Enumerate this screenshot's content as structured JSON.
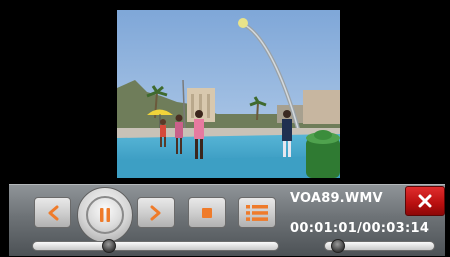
{
  "player": {
    "filename": "VOA89.WMV",
    "timecode": "00:01:01/00:03:14",
    "accent_color": "#ef7b2a",
    "close_color": "#c41414",
    "buttons": {
      "previous": "chevron-left-icon",
      "play_pause": "pause-icon",
      "next": "chevron-right-icon",
      "stop": "stop-icon",
      "playlist": "playlist-icon",
      "close": "close-icon"
    },
    "seek_position_fraction": 0.31,
    "volume_level_fraction": 0.12
  }
}
